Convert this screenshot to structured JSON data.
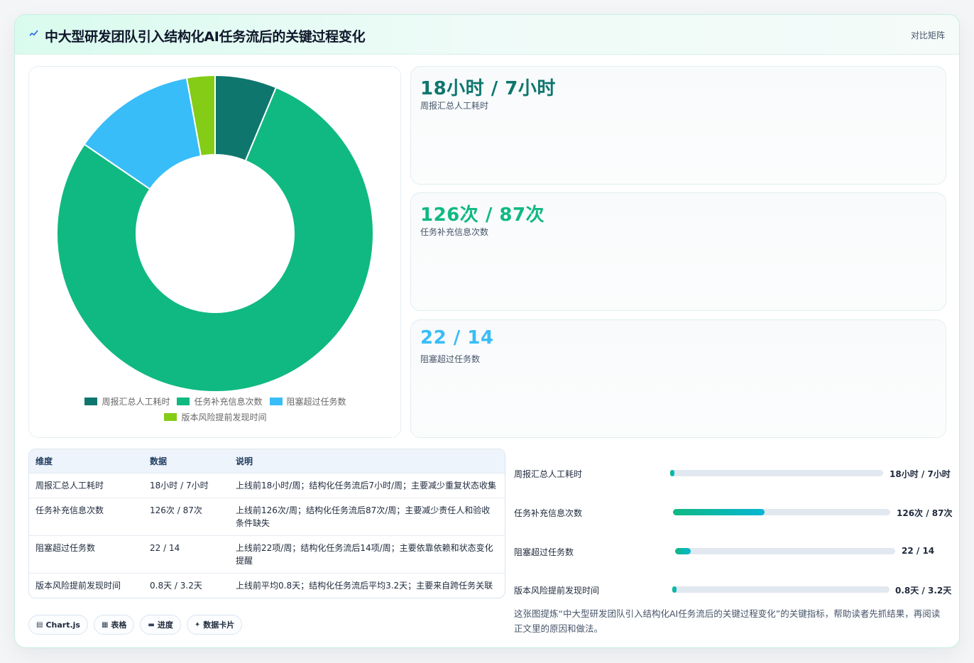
{
  "header": {
    "title": "中大型研发团队引入结构化AI任务流后的关键过程变化",
    "tag": "对比矩阵",
    "icon": "sparkline-icon"
  },
  "colors": {
    "accent": "#10b981",
    "teal_dark": "#0f766e",
    "sky": "#38bdf8",
    "lime": "#84cc16"
  },
  "chart_data": {
    "type": "pie",
    "labels": [
      "周报汇总人工耗时",
      "任务补充信息次数",
      "阻塞超过任务数",
      "版本风险提前发现时间"
    ],
    "values": [
      7,
      87,
      14,
      3.2
    ],
    "colors": [
      "#0f766e",
      "#10b981",
      "#38bdf8",
      "#84cc16"
    ],
    "legend_position": "bottom"
  },
  "kpis": [
    {
      "value": "18小时 / 7小时",
      "label": "周报汇总人工耗时",
      "color": "#0f766e"
    },
    {
      "value": "126次 / 87次",
      "label": "任务补充信息次数",
      "color": "#10b981"
    },
    {
      "value": "22 / 14",
      "label": "阻塞超过任务数",
      "color": "#38bdf8"
    }
  ],
  "table": {
    "headers": [
      "维度",
      "数据",
      "说明"
    ],
    "rows": [
      {
        "dim": "周报汇总人工耗时",
        "data": "18小时 / 7小时",
        "desc": "上线前18小时/周；结构化任务流后7小时/周；主要减少重复状态收集"
      },
      {
        "dim": "任务补充信息次数",
        "data": "126次 / 87次",
        "desc": "上线前126次/周；结构化任务流后87次/周；主要减少责任人和验收条件缺失"
      },
      {
        "dim": "阻塞超过任务数",
        "data": "22 / 14",
        "desc": "上线前22项/周；结构化任务流后14项/周；主要依靠依赖和状态变化提醒"
      },
      {
        "dim": "版本风险提前发现时间",
        "data": "0.8天 / 3.2天",
        "desc": "上线前平均0.8天；结构化任务流后平均3.2天；主要来自跨任务关联"
      }
    ]
  },
  "progress": [
    {
      "label": "周报汇总人工耗时",
      "value": "18小时 / 7小时",
      "fill": 0.02
    },
    {
      "label": "任务补充信息次数",
      "value": "126次 / 87次",
      "fill": 0.42
    },
    {
      "label": "阻塞超过任务数",
      "value": "22 / 14",
      "fill": 0.07
    },
    {
      "label": "版本风险提前发现时间",
      "value": "0.8天 / 3.2天",
      "fill": 0.02
    }
  ],
  "note": "这张图提炼“中大型研发团队引入结构化AI任务流后的关键过程变化”的关键指标，帮助读者先抓结果，再阅读正文里的原因和做法。",
  "chips": [
    {
      "icon": "chart-icon",
      "glyph": "▤",
      "label": "Chart.js"
    },
    {
      "icon": "table-icon",
      "glyph": "▦",
      "label": "表格"
    },
    {
      "icon": "progress-icon",
      "glyph": "▬",
      "label": "进度"
    },
    {
      "icon": "card-icon",
      "glyph": "✦",
      "label": "数据卡片"
    }
  ]
}
